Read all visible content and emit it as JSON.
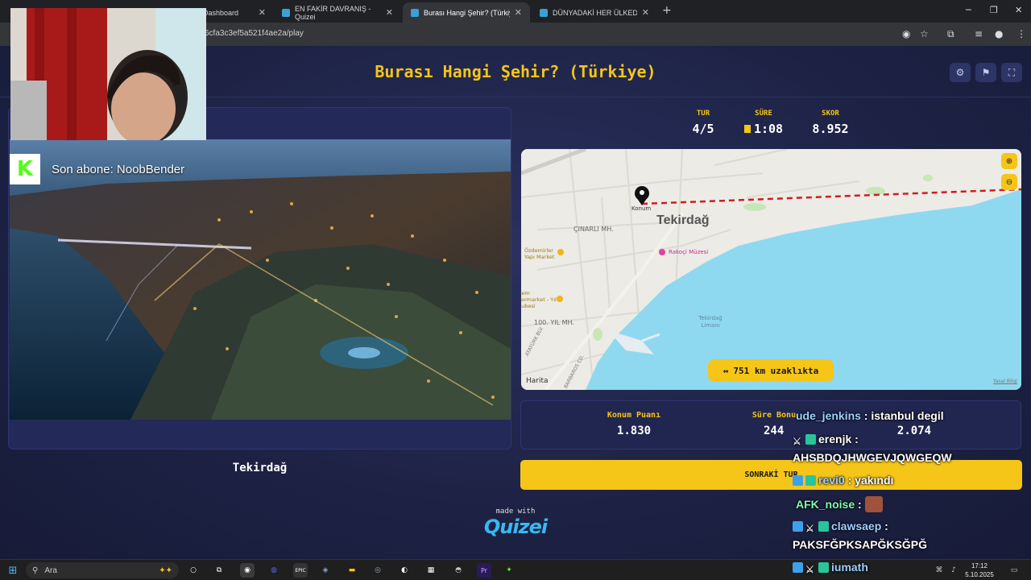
{
  "browser": {
    "tabs": [
      {
        "label": "",
        "fav_color": "#e53935",
        "active": false
      },
      {
        "label": "Dashboard",
        "fav_color": "#43a047",
        "active": false
      },
      {
        "label": "EN FAKİR DAVRANIŞ - Quizei",
        "fav_color": "#3aa0d8",
        "active": false
      },
      {
        "label": "Burası Hangi Şehir? (Türkiye) - Q",
        "fav_color": "#3aa0d8",
        "active": true
      },
      {
        "label": "DÜNYADAKİ HER ÜLKEDEN BİR",
        "fav_color": "#3aa0d8",
        "active": false
      }
    ],
    "url": "6cfa3c3ef5a521f4ae2a/play"
  },
  "game": {
    "title": "Burası Hangi Şehir? (Türkiye)",
    "stats": {
      "round_label": "TUR",
      "round_value": "4/5",
      "time_label": "SÜRE",
      "time_value": "1:08",
      "score_label": "SKOR",
      "score_value": "8.952"
    },
    "answer_city": "Tekirdağ",
    "map": {
      "pin_label": "Konum",
      "city_label": "Tekirdağ",
      "district_1": "ÇINARLI MH.",
      "district_2": "100. YIL MH.",
      "poi_museum": "Rakoçi Müzesi",
      "poi_1": "Özdemirler Yapı Market",
      "poi_2": "Cem permarket - Yıl Şubesi",
      "harbor": "Tekirdağ Limanı",
      "street_1": "ATATÜRK BLV.",
      "street_2": "BARBAROS CD.",
      "attribution": "Harita",
      "legal": "Yasal Bilgi"
    },
    "distance_text": "751 km uzaklıkta",
    "scores": {
      "location_label": "Konum Puanı",
      "location_value": "1.830",
      "time_bonus_label": "Süre Bonu",
      "time_bonus_value": "244",
      "total_value": "2.074"
    },
    "next_button": "SONRAKİ TUR",
    "made_with": "made with",
    "brand": "Quizei"
  },
  "stream": {
    "sub_alert": "Son abone: NoobBender",
    "chat": [
      {
        "user": "ude_jenkins",
        "message": "istanbul degil"
      },
      {
        "user": "erenjk",
        "message": "AHSBDQJHWGEVJQWGEQW"
      },
      {
        "user": "revi0",
        "message": "yakındı"
      },
      {
        "user": "AFK_noise",
        "message": ""
      },
      {
        "user": "clawsaep",
        "message": "PAKSFĞPKSAPĞKSĞPĞ"
      },
      {
        "user": "iumath",
        "message": ""
      }
    ]
  },
  "taskbar": {
    "search_placeholder": "Ara",
    "time": "17:12",
    "date": "5.10.2025"
  },
  "colors": {
    "accent": "#f5c518",
    "background": "#1c2142",
    "sea": "#8fd9f0",
    "route": "#cc1f1f"
  }
}
